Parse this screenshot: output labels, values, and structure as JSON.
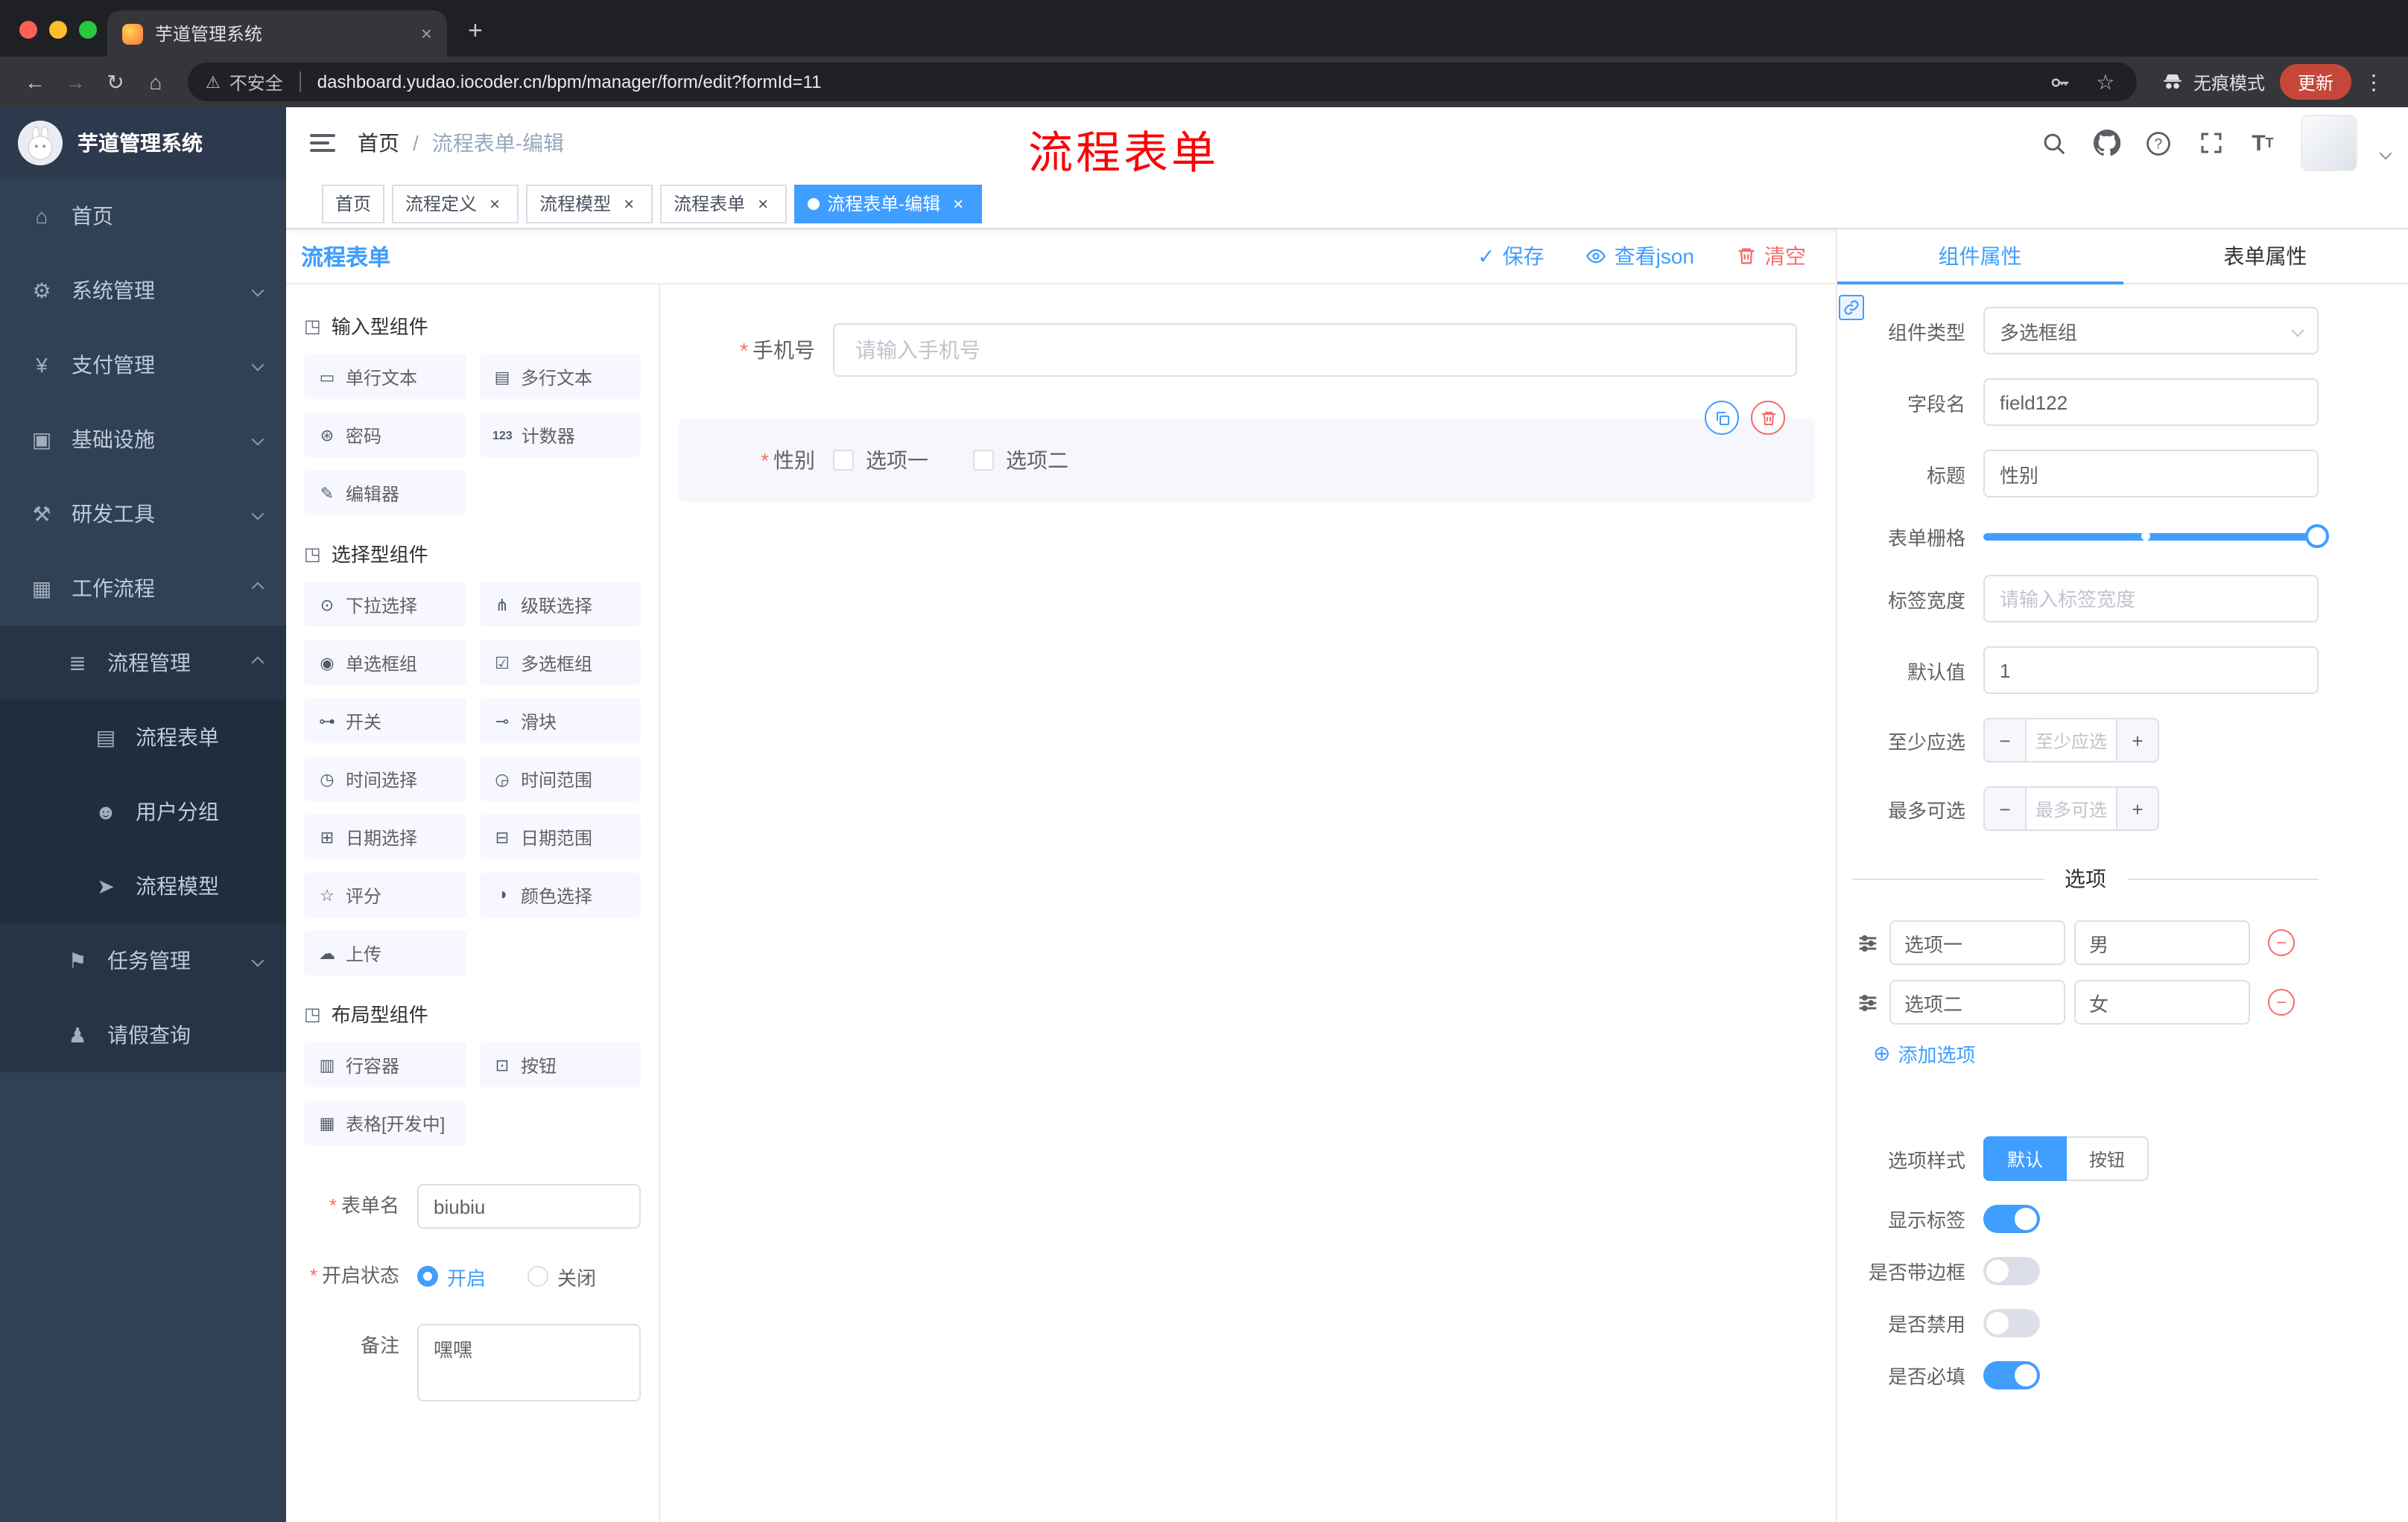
{
  "colors": {
    "accent": "#409eff",
    "danger": "#f56c6c",
    "annotation_red": "#fb0407",
    "sidebar_bg": "#304156",
    "active_tag": "#409eff",
    "chip_bg": "#f6f7ff"
  },
  "icons": {
    "back": "←",
    "forward": "→",
    "reload": "↻",
    "home_nav": "⌂",
    "warning": "⚠",
    "star": "☆",
    "menu_dots": "⋮",
    "close": "×",
    "new_tab": "+",
    "check": "✓",
    "minus": "−",
    "plus": "+",
    "circle_plus": "⊕",
    "section": "◳",
    "single_text": "▭",
    "multi_text": "▤",
    "password": "⊛",
    "counter": "123",
    "editor": "✎",
    "select": "⊙",
    "cascader": "⋔",
    "radio_group": "◉",
    "checkbox_group": "☑",
    "switch": "⊶",
    "slider": "⊸",
    "time": "◷",
    "time_range": "◶",
    "date": "⊞",
    "date_range": "⊟",
    "rate": "☆",
    "color": "◑",
    "upload": "☁",
    "row_container": "▥",
    "button": "⊡",
    "table": "▦",
    "home": "⌂",
    "system": "⚙",
    "pay": "¥",
    "infra": "▣",
    "devtool": "⚒",
    "workflow": "▦",
    "process": "≣",
    "form_doc": "▤",
    "user_group": "☻",
    "model": "➤",
    "task": "⚑",
    "person": "♟"
  },
  "browser": {
    "tab_title": "芋道管理系统",
    "security_label": "不安全",
    "url": "dashboard.yudao.iocoder.cn/bpm/manager/form/edit?formId=11",
    "incognito_label": "无痕模式",
    "update_label": "更新"
  },
  "header": {
    "logo_title": "芋道管理系统",
    "breadcrumb": {
      "root": "首页",
      "separator": "/",
      "current": "流程表单-编辑"
    },
    "annotation": "流程表单"
  },
  "tags": [
    {
      "label": "首页",
      "active": false,
      "closable": false
    },
    {
      "label": "流程定义",
      "active": false,
      "closable": true
    },
    {
      "label": "流程模型",
      "active": false,
      "closable": true
    },
    {
      "label": "流程表单",
      "active": false,
      "closable": true
    },
    {
      "label": "流程表单-编辑",
      "active": true,
      "closable": true
    }
  ],
  "sidebar": {
    "items": [
      {
        "label": "首页"
      },
      {
        "label": "系统管理"
      },
      {
        "label": "支付管理"
      },
      {
        "label": "基础设施"
      },
      {
        "label": "研发工具"
      },
      {
        "label": "工作流程"
      }
    ],
    "workflow": {
      "process_mgmt": {
        "label": "流程管理"
      },
      "process_children": [
        {
          "label": "流程表单"
        },
        {
          "label": "用户分组"
        },
        {
          "label": "流程模型"
        }
      ],
      "task_mgmt": {
        "label": "任务管理"
      },
      "leave_query": {
        "label": "请假查询"
      }
    }
  },
  "designer": {
    "title": "流程表单",
    "actions": {
      "save": "保存",
      "view_json": "查看json",
      "clear": "清空"
    },
    "sections": [
      {
        "title": "输入型组件",
        "items": [
          {
            "label": "单行文本"
          },
          {
            "label": "多行文本"
          },
          {
            "label": "密码"
          },
          {
            "label": "计数器"
          },
          {
            "label": "编辑器"
          }
        ]
      },
      {
        "title": "选择型组件",
        "items": [
          {
            "label": "下拉选择"
          },
          {
            "label": "级联选择"
          },
          {
            "label": "单选框组"
          },
          {
            "label": "多选框组"
          },
          {
            "label": "开关"
          },
          {
            "label": "滑块"
          },
          {
            "label": "时间选择"
          },
          {
            "label": "时间范围"
          },
          {
            "label": "日期选择"
          },
          {
            "label": "日期范围"
          },
          {
            "label": "评分"
          },
          {
            "label": "颜色选择"
          },
          {
            "label": "上传"
          }
        ]
      },
      {
        "title": "布局型组件",
        "items": [
          {
            "label": "行容器"
          },
          {
            "label": "按钮"
          },
          {
            "label": "表格[开发中]"
          }
        ]
      }
    ],
    "form_config": {
      "name_label": "表单名",
      "name_value": "biubiu",
      "status_label": "开启状态",
      "status_on": "开启",
      "status_off": "关闭",
      "remark_label": "备注",
      "remark_value": "嘿嘿"
    },
    "canvas": {
      "phone_label": "手机号",
      "phone_placeholder": "请输入手机号",
      "gender_label": "性别",
      "gender_option1": "选项一",
      "gender_option2": "选项二"
    }
  },
  "properties": {
    "tab_component": "组件属性",
    "tab_form": "表单属性",
    "component_type_label": "组件类型",
    "component_type_value": "多选框组",
    "field_name_label": "字段名",
    "field_name_value": "field122",
    "title_label": "标题",
    "title_value": "性别",
    "grid_label": "表单栅格",
    "label_width_label": "标签宽度",
    "label_width_placeholder": "请输入标签宽度",
    "default_label": "默认值",
    "default_value": "1",
    "min_label": "至少应选",
    "min_placeholder": "至少应选",
    "max_label": "最多可选",
    "max_placeholder": "最多可选",
    "options_title": "选项",
    "options": [
      {
        "label": "选项一",
        "value": "男"
      },
      {
        "label": "选项二",
        "value": "女"
      }
    ],
    "add_option": "添加选项",
    "style_label": "选项样式",
    "style_default": "默认",
    "style_button": "按钮",
    "switches": [
      {
        "label": "显示标签",
        "on": true
      },
      {
        "label": "是否带边框",
        "on": false
      },
      {
        "label": "是否禁用",
        "on": false
      },
      {
        "label": "是否必填",
        "on": true
      }
    ]
  }
}
